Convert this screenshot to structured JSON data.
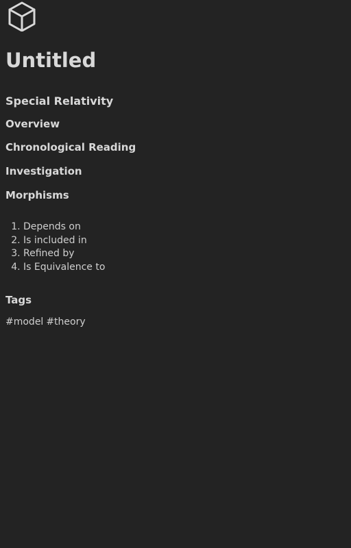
{
  "note": {
    "title": "Untitled",
    "subject": "Special Relativity"
  },
  "sections": {
    "overview": "Overview",
    "chronological_reading": "Chronological Reading",
    "investigation": "Investigation",
    "morphisms": "Morphisms",
    "tags": "Tags"
  },
  "morphisms": [
    {
      "number": "1.",
      "label": "Depends on"
    },
    {
      "number": "2.",
      "label": "Is included in"
    },
    {
      "number": "3.",
      "label": "Refined by"
    },
    {
      "number": "4.",
      "label": "Is Equivalence to"
    }
  ],
  "tags": [
    "#model",
    "#theory"
  ],
  "icons": {
    "logo": "cube-icon"
  },
  "colors": {
    "background": "#232323",
    "text": "#d4d4d4"
  }
}
